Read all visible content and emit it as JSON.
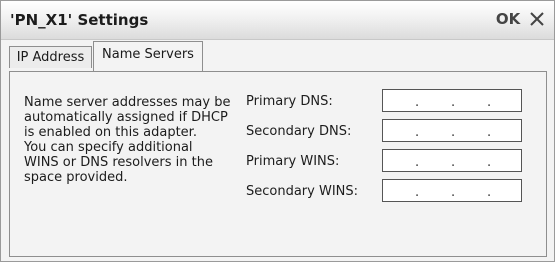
{
  "window": {
    "title": "'PN_X1' Settings",
    "ok_label": "OK",
    "close_icon": "close-icon"
  },
  "tabs": [
    {
      "label": "IP Address",
      "active": false
    },
    {
      "label": "Name Servers",
      "active": true
    }
  ],
  "description_lines": [
    "Name server addresses may be",
    "automatically assigned if DHCP",
    "is enabled on this adapter.",
    "You can specify additional",
    "WINS or DNS resolvers in the",
    "space provided."
  ],
  "fields": [
    {
      "label": "Primary DNS:",
      "value": ""
    },
    {
      "label": "Secondary DNS:",
      "value": ""
    },
    {
      "label": "Primary WINS:",
      "value": ""
    },
    {
      "label": "Secondary WINS:",
      "value": ""
    }
  ],
  "ip_separator": "."
}
